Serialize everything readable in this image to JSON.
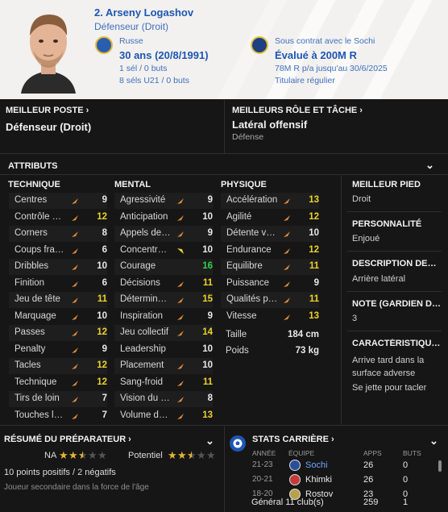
{
  "player": {
    "name": "2. Arseny Logashov",
    "position": "Défenseur (Droit)",
    "nationality": "Russe",
    "age": "30 ans (20/8/1991)",
    "caps": "1 sél / 0 buts",
    "u21_caps": "8 séls U21 / 0 buts",
    "contract": "Sous contrat avec le Sochi",
    "value": "Évalué à 200M R",
    "wage": "78M R p/a jusqu'au 30/6/2025",
    "squad_status": "Titulaire régulier"
  },
  "best_position": {
    "heading": "MEILLEUR POSTE",
    "value": "Défenseur (Droit)"
  },
  "best_role": {
    "heading": "MEILLEURS RÔLE ET TÂCHE",
    "value": "Latéral offensif",
    "duty": "Défense"
  },
  "attributes": {
    "heading": "ATTRIBUTS",
    "technique": {
      "heading": "TECHNIQUE",
      "items": [
        {
          "name": "Centres",
          "value": "9",
          "color": "white",
          "arrow": "up"
        },
        {
          "name": "Contrôle de balle",
          "value": "12",
          "color": "yellow",
          "arrow": "up"
        },
        {
          "name": "Corners",
          "value": "8",
          "color": "white",
          "arrow": "up"
        },
        {
          "name": "Coups francs",
          "value": "6",
          "color": "white",
          "arrow": "up"
        },
        {
          "name": "Dribbles",
          "value": "10",
          "color": "white",
          "arrow": "up"
        },
        {
          "name": "Finition",
          "value": "6",
          "color": "white",
          "arrow": "up"
        },
        {
          "name": "Jeu de tête",
          "value": "11",
          "color": "yellow",
          "arrow": "up"
        },
        {
          "name": "Marquage",
          "value": "10",
          "color": "white",
          "arrow": "up"
        },
        {
          "name": "Passes",
          "value": "12",
          "color": "yellow",
          "arrow": "up"
        },
        {
          "name": "Penalty",
          "value": "9",
          "color": "white",
          "arrow": "up"
        },
        {
          "name": "Tacles",
          "value": "12",
          "color": "yellow",
          "arrow": "up"
        },
        {
          "name": "Technique",
          "value": "12",
          "color": "yellow",
          "arrow": "up"
        },
        {
          "name": "Tirs de loin",
          "value": "7",
          "color": "white",
          "arrow": "up"
        },
        {
          "name": "Touches longues",
          "value": "7",
          "color": "white",
          "arrow": "up"
        }
      ]
    },
    "mental": {
      "heading": "MENTAL",
      "items": [
        {
          "name": "Agressivité",
          "value": "9",
          "color": "white",
          "arrow": "up"
        },
        {
          "name": "Anticipation",
          "value": "10",
          "color": "white",
          "arrow": "up"
        },
        {
          "name": "Appels de balle",
          "value": "9",
          "color": "white",
          "arrow": "up"
        },
        {
          "name": "Concentration",
          "value": "10",
          "color": "white",
          "arrow": "down"
        },
        {
          "name": "Courage",
          "value": "16",
          "color": "green",
          "arrow": "none"
        },
        {
          "name": "Décisions",
          "value": "11",
          "color": "yellow",
          "arrow": "up"
        },
        {
          "name": "Détermination",
          "value": "15",
          "color": "yellow",
          "arrow": "up"
        },
        {
          "name": "Inspiration",
          "value": "9",
          "color": "white",
          "arrow": "up"
        },
        {
          "name": "Jeu collectif",
          "value": "14",
          "color": "yellow",
          "arrow": "up"
        },
        {
          "name": "Leadership",
          "value": "10",
          "color": "white",
          "arrow": "none"
        },
        {
          "name": "Placement",
          "value": "10",
          "color": "white",
          "arrow": "up"
        },
        {
          "name": "Sang-froid",
          "value": "11",
          "color": "yellow",
          "arrow": "up"
        },
        {
          "name": "Vision du jeu",
          "value": "8",
          "color": "white",
          "arrow": "up"
        },
        {
          "name": "Volume de jeu",
          "value": "13",
          "color": "yellow",
          "arrow": "up"
        }
      ]
    },
    "physique": {
      "heading": "PHYSIQUE",
      "items": [
        {
          "name": "Accélération",
          "value": "13",
          "color": "yellow",
          "arrow": "up"
        },
        {
          "name": "Agilité",
          "value": "12",
          "color": "yellow",
          "arrow": "up"
        },
        {
          "name": "Détente verticale",
          "value": "10",
          "color": "white",
          "arrow": "up"
        },
        {
          "name": "Endurance",
          "value": "12",
          "color": "yellow",
          "arrow": "up"
        },
        {
          "name": "Équilibre",
          "value": "11",
          "color": "yellow",
          "arrow": "up"
        },
        {
          "name": "Puissance",
          "value": "9",
          "color": "white",
          "arrow": "up"
        },
        {
          "name": "Qualités physiques",
          "value": "11",
          "color": "yellow",
          "arrow": "up"
        },
        {
          "name": "Vitesse",
          "value": "13",
          "color": "yellow",
          "arrow": "up"
        }
      ],
      "height_label": "Taille",
      "height": "184 cm",
      "weight_label": "Poids",
      "weight": "73 kg"
    }
  },
  "side": {
    "best_foot_h": "MEILLEUR PIED",
    "best_foot": "Droit",
    "personality_h": "PERSONNALITÉ",
    "personality": "Enjoué",
    "description_h": "DESCRIPTION DES MÉDIAS",
    "description": "Arrière latéral",
    "note_h": "NOTE (GARDIEN DE BUT)",
    "note": "3",
    "traits_h": "CARACTÉRISTIQUES",
    "trait1": "Arrive tard dans la",
    "trait1b": "surface adverse",
    "trait2": "Se jette pour tacler"
  },
  "coach": {
    "heading": "RÉSUMÉ DU PRÉPARATEUR",
    "na_label": "NA",
    "na_stars": 2.5,
    "potential_label": "Potentiel",
    "potential_stars": 2.5,
    "points": "10 points positifs / 2 négatifs",
    "summary": "Joueur secondaire dans la force de l'âge"
  },
  "career": {
    "heading": "STATS CARRIÈRE",
    "cols": {
      "year": "ANNÉE",
      "team": "ÉQUIPE",
      "apps": "APPS",
      "goals": "BUTS"
    },
    "rows": [
      {
        "year": "21-23",
        "team": "Sochi",
        "apps": "26",
        "goals": "0"
      },
      {
        "year": "20-21",
        "team": "Khimki",
        "apps": "26",
        "goals": "0"
      },
      {
        "year": "18-20",
        "team": "Rostov",
        "apps": "23",
        "goals": "0"
      }
    ],
    "total_label": "Général 11 club(s)",
    "total_apps": "259",
    "total_goals": "1"
  },
  "colors": {
    "white": "#e8e8e8",
    "yellow": "#ecd22a",
    "green": "#37cf4e",
    "arrow": "#e08a3a",
    "link": "#1d56b3"
  }
}
